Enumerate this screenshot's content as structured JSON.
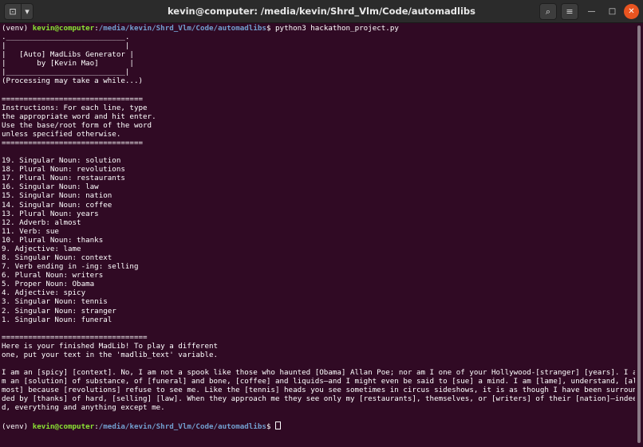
{
  "window": {
    "title": "kevin@computer: /media/kevin/Shrd_Vlm/Code/automadlibs",
    "icons": {
      "new_tab": "new-tab-icon",
      "dropdown": "chevron-down-icon",
      "search": "search-icon",
      "menu": "hamburger-menu-icon",
      "minimize": "minimize-icon",
      "maximize": "maximize-icon",
      "close": "close-icon"
    },
    "glyphs": {
      "new_tab": "⊡",
      "dropdown": "▾",
      "search": "⌕",
      "menu": "≡",
      "minimize": "—",
      "maximize": "□",
      "close": "✕"
    },
    "colors": {
      "background": "#300a24",
      "user_host": "#8ae234",
      "path": "#729fcf",
      "close_button": "#e95420"
    }
  },
  "terminal": {
    "prompt": {
      "venv": "(venv) ",
      "user_host": "kevin@computer",
      "colon": ":",
      "path": "/media/kevin/Shrd_Vlm/Code/automadlibs",
      "dollar": "$ "
    },
    "command": "python3 hackathon_project.py",
    "banner": [
      ".___________________________.",
      "|                           |",
      "|   [Auto] MadLibs Generator |",
      "|       by [Kevin Mao]       |",
      "|___________________________|",
      "(Processing may take a while...)"
    ],
    "rule_short": "================================",
    "instructions": [
      "Instructions: For each line, type",
      "the appropriate word and hit enter.",
      "Use the base/root form of the word",
      "unless specified otherwise."
    ],
    "entries": [
      "19. Singular Noun: solution",
      "18. Plural Noun: revolutions",
      "17. Plural Noun: restaurants",
      "16. Singular Noun: law",
      "15. Singular Noun: nation",
      "14. Singular Noun: coffee",
      "13. Plural Noun: years",
      "12. Adverb: almost",
      "11. Verb: sue",
      "10. Plural Noun: thanks",
      "9. Adjective: lame",
      "8. Singular Noun: context",
      "7. Verb ending in -ing: selling",
      "6. Plural Noun: writers",
      "5. Proper Noun: Obama",
      "4. Adjective: spicy",
      "3. Singular Noun: tennis",
      "2. Singular Noun: stranger",
      "1. Singular Noun: funeral"
    ],
    "rule_long": "=================================",
    "finished": [
      "Here is your finished MadLib! To play a different",
      "one, put your text in the 'madlib_text' variable."
    ],
    "madlib_lines": [
      "I am an [spicy] [context]. No, I am not a spook like those who haunted [Obama] Allan Poe; nor am I one of your Hollywood-[stranger] [years]. I a",
      "m an [solution] of substance, of [funeral] and bone, [coffee] and liquids—and I might even be said to [sue] a mind. I am [lame], understand, [al",
      "most] because [revolutions] refuse to see me. Like the [tennis] heads you see sometimes in circus sideshows, it is as though I have been surroun",
      "ded by [thanks] of hard, [selling] [law]. When they approach me they see only my [restaurants], themselves, or [writers] of their [nation]—indee",
      "d, everything and anything except me."
    ]
  }
}
